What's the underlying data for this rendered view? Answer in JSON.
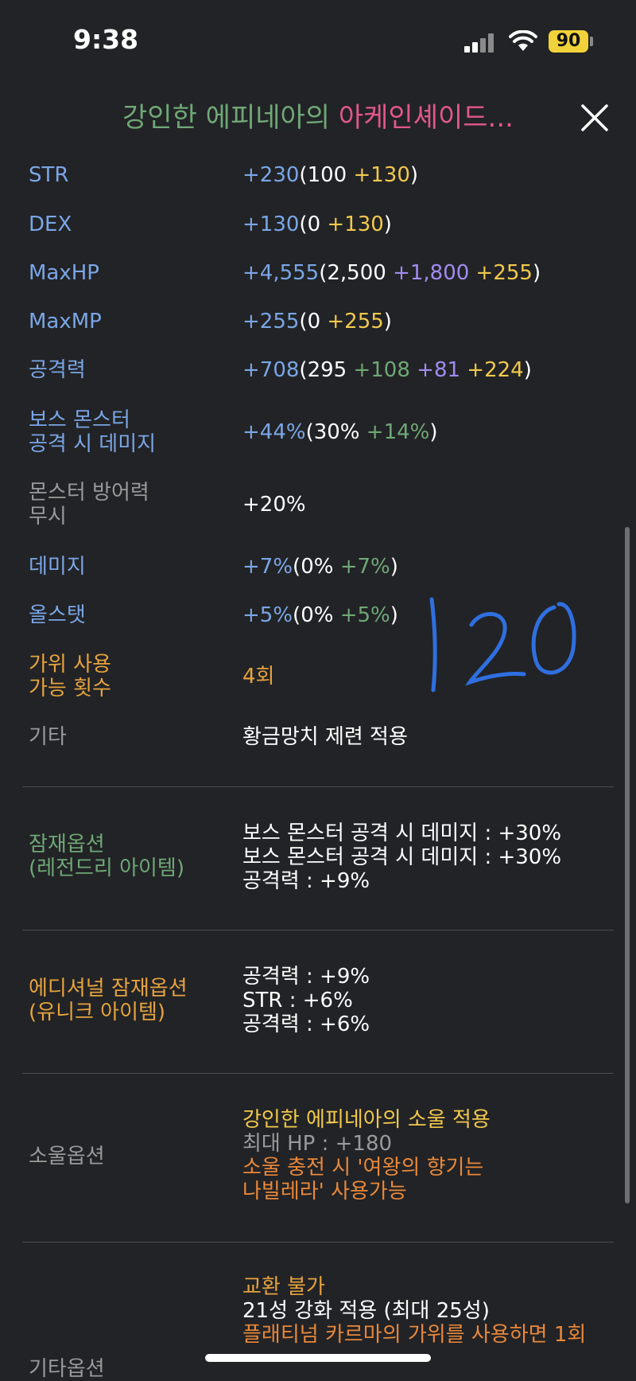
{
  "status_bar": {
    "time": "9:38",
    "battery": "90"
  },
  "title": {
    "prefix": "강인한 에피네아의 ",
    "item": "아케인셰이드..."
  },
  "stats": [
    {
      "label": "STR",
      "label_color": "blue",
      "parts": [
        {
          "text": "+230",
          "color": "blue"
        },
        {
          "text": "(100 ",
          "color": "white"
        },
        {
          "text": "+130",
          "color": "yellow"
        },
        {
          "text": ")",
          "color": "white"
        }
      ]
    },
    {
      "label": "DEX",
      "label_color": "blue",
      "parts": [
        {
          "text": "+130",
          "color": "blue"
        },
        {
          "text": "(0 ",
          "color": "white"
        },
        {
          "text": "+130",
          "color": "yellow"
        },
        {
          "text": ")",
          "color": "white"
        }
      ]
    },
    {
      "label": "MaxHP",
      "label_color": "blue",
      "parts": [
        {
          "text": "+4,555",
          "color": "blue"
        },
        {
          "text": "(2,500 ",
          "color": "white"
        },
        {
          "text": "+1,800",
          "color": "purple"
        },
        {
          "text": " ",
          "color": "white"
        },
        {
          "text": "+255",
          "color": "yellow"
        },
        {
          "text": ")",
          "color": "white"
        }
      ]
    },
    {
      "label": "MaxMP",
      "label_color": "blue",
      "parts": [
        {
          "text": "+255",
          "color": "blue"
        },
        {
          "text": "(0 ",
          "color": "white"
        },
        {
          "text": "+255",
          "color": "yellow"
        },
        {
          "text": ")",
          "color": "white"
        }
      ]
    },
    {
      "label": "공격력",
      "label_color": "blue",
      "parts": [
        {
          "text": "+708",
          "color": "blue"
        },
        {
          "text": "(295 ",
          "color": "white"
        },
        {
          "text": "+108",
          "color": "green"
        },
        {
          "text": " ",
          "color": "white"
        },
        {
          "text": "+81",
          "color": "purple"
        },
        {
          "text": " ",
          "color": "white"
        },
        {
          "text": "+224",
          "color": "yellow"
        },
        {
          "text": ")",
          "color": "white"
        }
      ]
    },
    {
      "label": "보스 몬스터\n공격 시 데미지",
      "label_color": "blue",
      "parts": [
        {
          "text": "+44%",
          "color": "blue"
        },
        {
          "text": "(30% ",
          "color": "white"
        },
        {
          "text": "+14%",
          "color": "green"
        },
        {
          "text": ")",
          "color": "white"
        }
      ]
    },
    {
      "label": "몬스터 방어력\n무시",
      "label_color": "gray",
      "parts": [
        {
          "text": "+20%",
          "color": "white"
        }
      ]
    },
    {
      "label": "데미지",
      "label_color": "blue",
      "parts": [
        {
          "text": "+7%",
          "color": "blue"
        },
        {
          "text": "(0% ",
          "color": "white"
        },
        {
          "text": "+7%",
          "color": "green"
        },
        {
          "text": ")",
          "color": "white"
        }
      ]
    },
    {
      "label": "올스탯",
      "label_color": "blue",
      "parts": [
        {
          "text": "+5%",
          "color": "blue"
        },
        {
          "text": "(0% ",
          "color": "white"
        },
        {
          "text": "+5%",
          "color": "green"
        },
        {
          "text": ")",
          "color": "white"
        }
      ]
    },
    {
      "label": "가위 사용\n가능 횟수",
      "label_color": "orange",
      "parts": [
        {
          "text": "4회",
          "color": "orange"
        }
      ]
    },
    {
      "label": "기타",
      "label_color": "gray",
      "parts": [
        {
          "text": "황금망치 제련 적용",
          "color": "white"
        }
      ]
    }
  ],
  "handwritten_note": "120",
  "potential": {
    "label": "잠재옵션\n(레전드리 아이템)",
    "lines": [
      "보스 몬스터 공격 시 데미지 : +30%",
      "보스 몬스터 공격 시 데미지 : +30%",
      "공격력 : +9%"
    ]
  },
  "additional_potential": {
    "label": "에디셔널 잠재옵션\n(유니크 아이템)",
    "lines": [
      "공격력 : +9%",
      "STR : +6%",
      "공격력 : +6%"
    ]
  },
  "soul": {
    "label": "소울옵션",
    "lines": [
      {
        "text": "강인한 에피네아의 소울 적용",
        "color": "yellow"
      },
      {
        "text": "최대 HP : +180",
        "color": "gray"
      },
      {
        "text": "소울 충전 시 '여왕의 향기는",
        "color": "orange2"
      },
      {
        "text": "나빌레라' 사용가능",
        "color": "orange2"
      }
    ]
  },
  "etc": {
    "label": "기타옵션",
    "lines": [
      {
        "text": "교환 불가",
        "color": "orange"
      },
      {
        "text": "21성 강화 적용 (최대 25성)",
        "color": "white"
      },
      {
        "text": "플래티넘 카르마의 가위를 사용하면 1회",
        "color": "orange2"
      }
    ]
  },
  "colors": {
    "background": "#222326",
    "blue": "#7aa6e6",
    "yellow": "#f2c94c",
    "purple": "#a18cf0",
    "green": "#6fa876",
    "pink": "#e2578a",
    "orange": "#e6a33e",
    "gray": "#9a9a9a"
  }
}
